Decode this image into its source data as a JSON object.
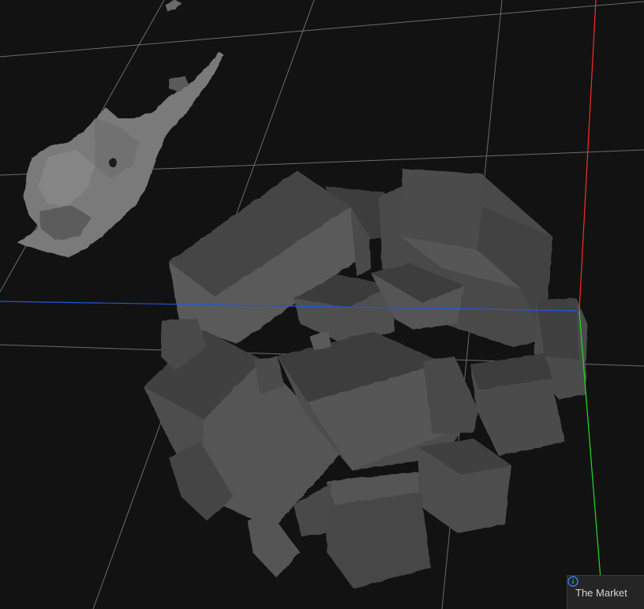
{
  "scene": {
    "background": "#121212",
    "grid_color": "#8a8a8a",
    "axis_colors": {
      "x": "#ff2a2a",
      "y": "#22dd22",
      "z": "#2255dd"
    },
    "mesh_color": "#4a4a4a",
    "mesh_highlight": "#5e5e5e",
    "debris_color": "#7a7a7a"
  },
  "notification": {
    "icon": "info-icon",
    "icon_color": "#3794ff",
    "text": "The Market"
  }
}
